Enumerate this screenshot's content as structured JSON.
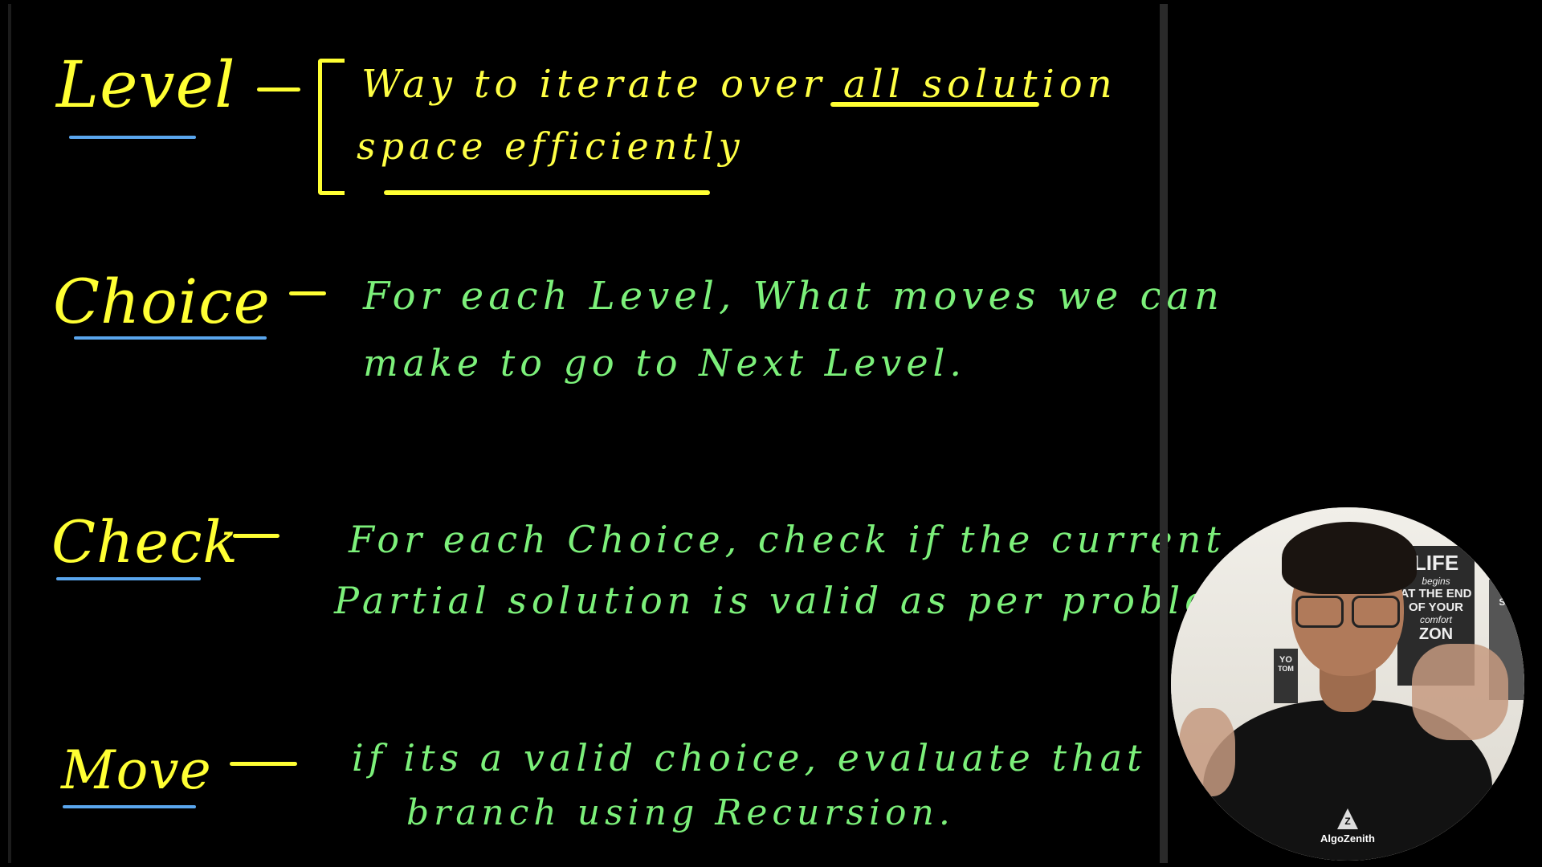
{
  "board": {
    "rows": [
      {
        "term": "Level",
        "lines": [
          "Way to iterate over all solution",
          "space efficiently"
        ]
      },
      {
        "term": "Choice",
        "lines": [
          "For each Level, What moves we can",
          "make to go to Next Level."
        ]
      },
      {
        "term": "Check",
        "lines": [
          "For each Choice, check if the current",
          "Partial solution is valid as per problem"
        ]
      },
      {
        "term": "Move",
        "lines": [
          "if its a valid choice, evaluate that",
          "branch using Recursion."
        ]
      }
    ]
  },
  "webcam": {
    "poster_main": [
      "LIFE",
      "begins",
      "AT THE END",
      "OF YOUR",
      "comfort",
      "ZON"
    ],
    "poster_right": [
      "THER",
      "SUB"
    ],
    "poster_left": [
      "YO",
      "TOM"
    ],
    "brand": "AlgoZenith",
    "brand_icon_letter": "Z"
  },
  "colors": {
    "background": "#000000",
    "term": "#ffff33",
    "description": "#7cf07a",
    "underline": "#5aa6ee"
  }
}
